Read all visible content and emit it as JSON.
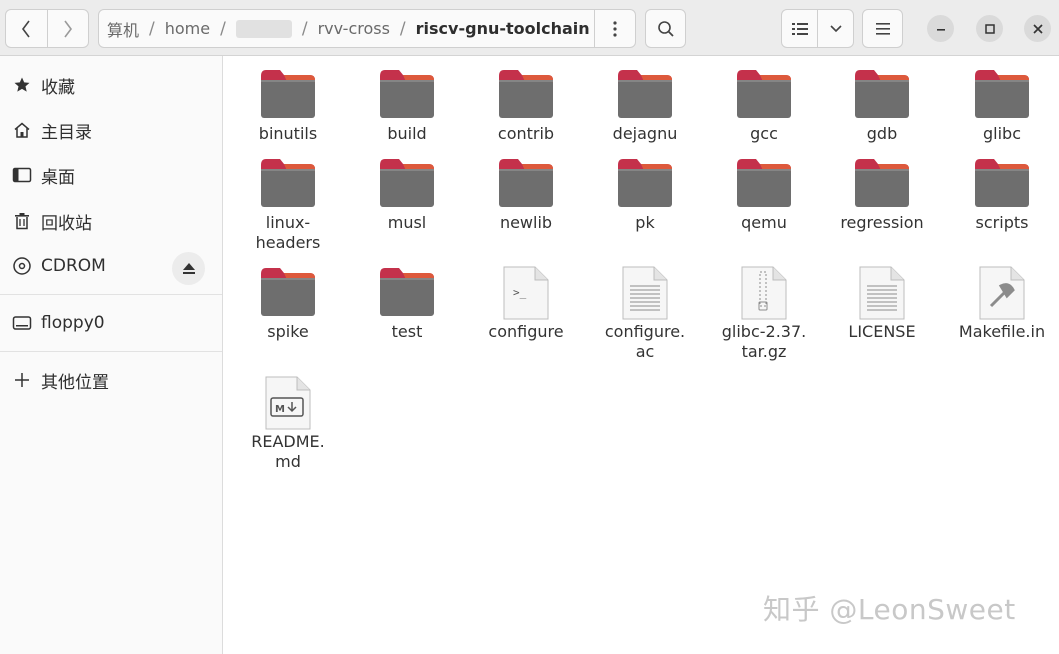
{
  "header": {
    "back_icon": "chevron-left-icon",
    "forward_icon": "chevron-right-icon",
    "path": [
      "算机",
      "home",
      "rvv-cross",
      "riscv-gnu-toolchain"
    ],
    "path_separator": "/"
  },
  "sidebar": {
    "items": [
      {
        "label": "收藏",
        "icon": "star-icon"
      },
      {
        "label": "主目录",
        "icon": "home-icon"
      },
      {
        "label": "桌面",
        "icon": "desktop-icon"
      },
      {
        "label": "回收站",
        "icon": "trash-icon"
      },
      {
        "label": "CDROM",
        "icon": "disc-icon"
      },
      {
        "label": "floppy0",
        "icon": "drive-icon"
      },
      {
        "label": "其他位置",
        "icon": "plus-icon"
      }
    ]
  },
  "files": [
    {
      "name": "binutils",
      "type": "folder"
    },
    {
      "name": "build",
      "type": "folder"
    },
    {
      "name": "contrib",
      "type": "folder"
    },
    {
      "name": "dejagnu",
      "type": "folder"
    },
    {
      "name": "gcc",
      "type": "folder"
    },
    {
      "name": "gdb",
      "type": "folder"
    },
    {
      "name": "glibc",
      "type": "folder"
    },
    {
      "name": "linux-\nheaders",
      "type": "folder"
    },
    {
      "name": "musl",
      "type": "folder"
    },
    {
      "name": "newlib",
      "type": "folder"
    },
    {
      "name": "pk",
      "type": "folder"
    },
    {
      "name": "qemu",
      "type": "folder"
    },
    {
      "name": "regression",
      "type": "folder"
    },
    {
      "name": "scripts",
      "type": "folder"
    },
    {
      "name": "spike",
      "type": "folder"
    },
    {
      "name": "test",
      "type": "folder"
    },
    {
      "name": "configure",
      "type": "script"
    },
    {
      "name": "configure.\nac",
      "type": "text"
    },
    {
      "name": "glibc-2.37.\ntar.gz",
      "type": "archive"
    },
    {
      "name": "LICENSE",
      "type": "text"
    },
    {
      "name": "Makefile.in",
      "type": "makefile"
    },
    {
      "name": "README.\nmd",
      "type": "markdown"
    }
  ],
  "watermark": "知乎 @LeonSweet",
  "colors": {
    "folder_tab": "#c4314b",
    "folder_tab_edge": "#e2603a",
    "folder_body": "#6e6e6e",
    "header_bg": "#ececec"
  }
}
